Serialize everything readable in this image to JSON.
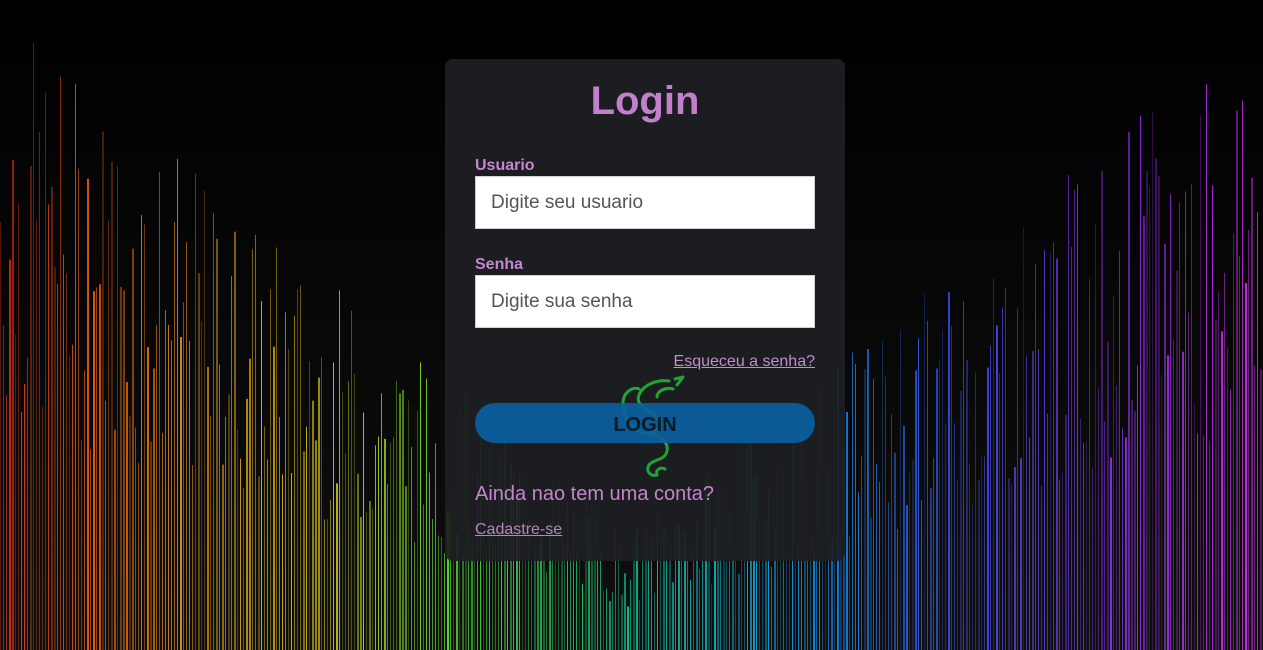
{
  "background": {
    "name": "rainbow-spectrum-lines",
    "colors": [
      "#ff2a10",
      "#ff8a00",
      "#ffe600",
      "#3dff2a",
      "#00d9a0",
      "#00a8ff",
      "#2f4dff",
      "#8a2cff",
      "#e52cff"
    ]
  },
  "login": {
    "title": "Login",
    "username": {
      "label": "Usuario",
      "placeholder": "Digite seu usuario"
    },
    "password": {
      "label": "Senha",
      "placeholder": "Digite sua senha"
    },
    "forgot_password": "Esqueceu a senha?",
    "submit_label": "LOGIN",
    "signup_prompt": "Ainda nao tem uma conta?",
    "signup_link": "Cadastre-se",
    "logo_icon": "razer-snake-logo-icon",
    "colors": {
      "title": "#c27fcc",
      "button": "#0a5fa0",
      "logo": "#1ed43a"
    }
  }
}
